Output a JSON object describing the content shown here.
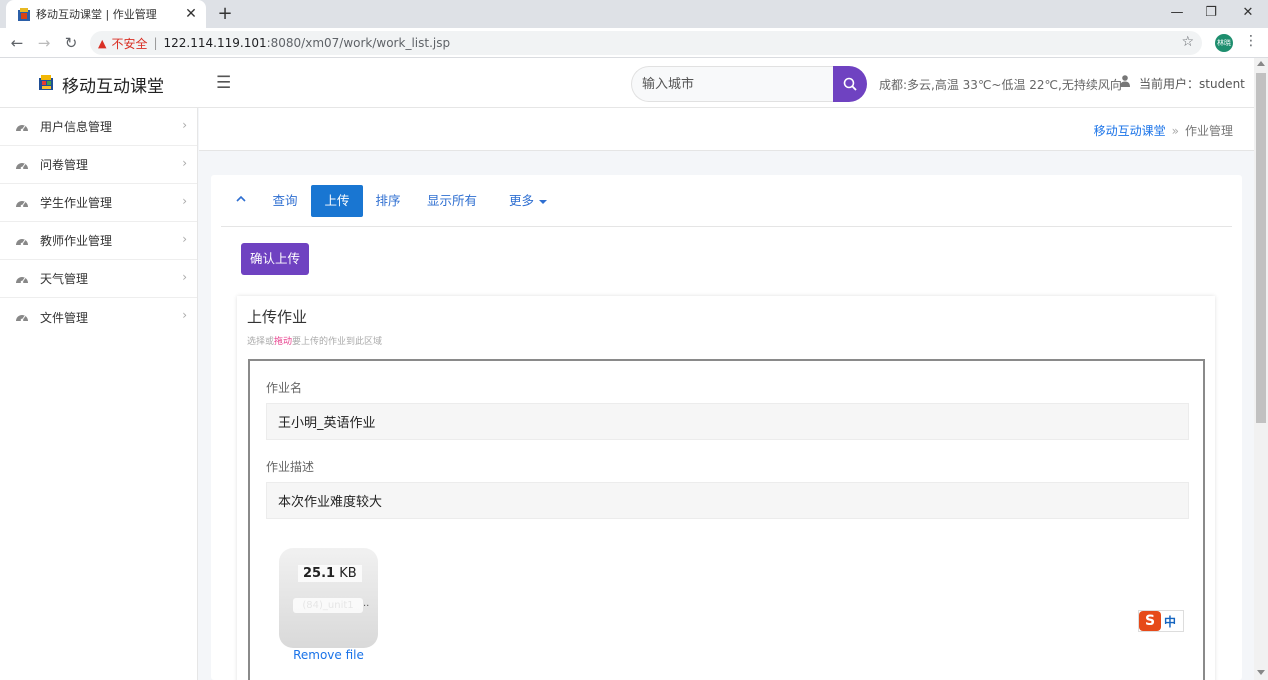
{
  "browser": {
    "tab_title": "移动互动课堂 | 作业管理",
    "tab_close": "✕",
    "new_tab": "+",
    "security_label": "不安全",
    "url_separator": "|",
    "url_host": "122.114.119.101",
    "url_rest": ":8080/xm07/work/work_list.jsp",
    "profile_initials": "林晓"
  },
  "header": {
    "brand": "移动互动课堂",
    "city_placeholder": "输入城市",
    "weather_text": "成都:多云,高温 33℃~低温 22℃,无持续风向",
    "user_label": "当前用户：student"
  },
  "sidebar": {
    "items": [
      {
        "label": "用户信息管理",
        "icon": "dashboard-icon"
      },
      {
        "label": "问卷管理",
        "icon": "dashboard-icon"
      },
      {
        "label": "学生作业管理",
        "icon": "dashboard-icon"
      },
      {
        "label": "教师作业管理",
        "icon": "dashboard-icon"
      },
      {
        "label": "天气管理",
        "icon": "dashboard-icon"
      },
      {
        "label": "文件管理",
        "icon": "dashboard-icon"
      }
    ]
  },
  "breadcrumb": {
    "home": "移动互动课堂",
    "separator": "»",
    "current": "作业管理"
  },
  "toolbar": {
    "tabs": [
      {
        "label": "查询",
        "active": false
      },
      {
        "label": "上传",
        "active": true
      },
      {
        "label": "排序",
        "active": false
      },
      {
        "label": "显示所有",
        "active": false
      },
      {
        "label": "更多",
        "active": false
      }
    ],
    "confirm_label": "确认上传"
  },
  "upload": {
    "title": "上传作业",
    "subtitle_pre": "选择或",
    "subtitle_em": "拖动",
    "subtitle_post": "要上传的作业到此区域",
    "name_label": "作业名",
    "name_value": "王小明_英语作业",
    "desc_label": "作业描述",
    "desc_value": "本次作业难度较大",
    "file_size_num": "25.1",
    "file_size_unit": "KB",
    "file_name": "(84)_unit1",
    "file_ellipsis": "..",
    "remove_label": "Remove file"
  },
  "ime": {
    "logo": "S",
    "mode": "中"
  },
  "colors": {
    "accent_purple": "#6f42c1",
    "tab_active_blue": "#1976d2",
    "link_blue": "#1a73e8",
    "warning_red": "#d93025"
  }
}
